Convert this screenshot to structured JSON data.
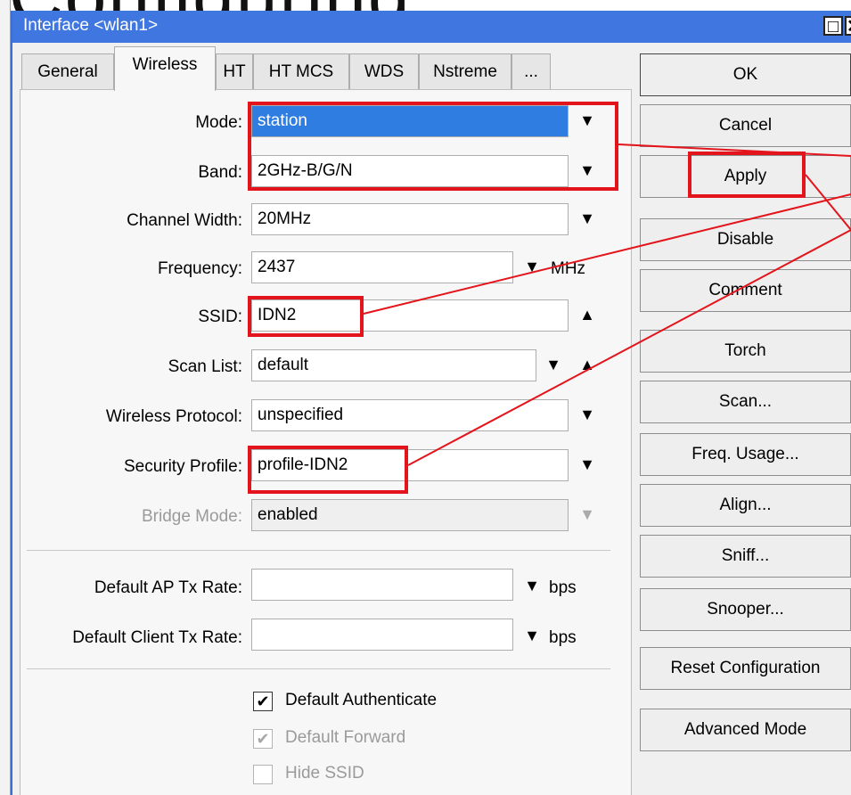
{
  "background_heading": "Configuring",
  "window": {
    "title": "Interface <wlan1>",
    "maximize_glyph": "□",
    "close_glyph": "✕"
  },
  "tabs": [
    {
      "label": "General",
      "active": false
    },
    {
      "label": "Wireless",
      "active": true
    },
    {
      "label": "HT",
      "active": false
    },
    {
      "label": "HT MCS",
      "active": false
    },
    {
      "label": "WDS",
      "active": false
    },
    {
      "label": "Nstreme",
      "active": false
    },
    {
      "label": "...",
      "active": false
    }
  ],
  "fields": {
    "mode": {
      "label": "Mode:",
      "value": "station"
    },
    "band": {
      "label": "Band:",
      "value": "2GHz-B/G/N"
    },
    "channel_width": {
      "label": "Channel Width:",
      "value": "20MHz"
    },
    "frequency": {
      "label": "Frequency:",
      "value": "2437",
      "unit": "MHz"
    },
    "ssid": {
      "label": "SSID:",
      "value": "IDN2"
    },
    "scan_list": {
      "label": "Scan List:",
      "value": "default"
    },
    "wireless_protocol": {
      "label": "Wireless Protocol:",
      "value": "unspecified"
    },
    "security_profile": {
      "label": "Security Profile:",
      "value": "profile-IDN2"
    },
    "bridge_mode": {
      "label": "Bridge Mode:",
      "value": "enabled"
    },
    "default_ap_tx_rate": {
      "label": "Default AP Tx Rate:",
      "value": "",
      "unit": "bps"
    },
    "default_client_tx_rate": {
      "label": "Default Client Tx Rate:",
      "value": "",
      "unit": "bps"
    }
  },
  "checkboxes": {
    "default_authenticate": {
      "label": "Default Authenticate",
      "checked": true,
      "enabled": true
    },
    "default_forward": {
      "label": "Default Forward",
      "checked": true,
      "enabled": false
    },
    "hide_ssid": {
      "label": "Hide SSID",
      "checked": false,
      "enabled": false
    }
  },
  "buttons": {
    "ok": "OK",
    "cancel": "Cancel",
    "apply": "Apply",
    "disable": "Disable",
    "comment": "Comment",
    "torch": "Torch",
    "scan": "Scan...",
    "freq_usage": "Freq. Usage...",
    "align": "Align...",
    "sniff": "Sniff...",
    "snooper": "Snooper...",
    "reset_configuration": "Reset Configuration",
    "advanced_mode": "Advanced Mode"
  },
  "glyphs": {
    "dropdown": "▼",
    "dropdown_bar": "‾",
    "up": "▲",
    "check": "✔"
  },
  "colors": {
    "titlebar": "#3f76e0",
    "selection": "#2f7de1",
    "annotation": "#e3141b"
  }
}
